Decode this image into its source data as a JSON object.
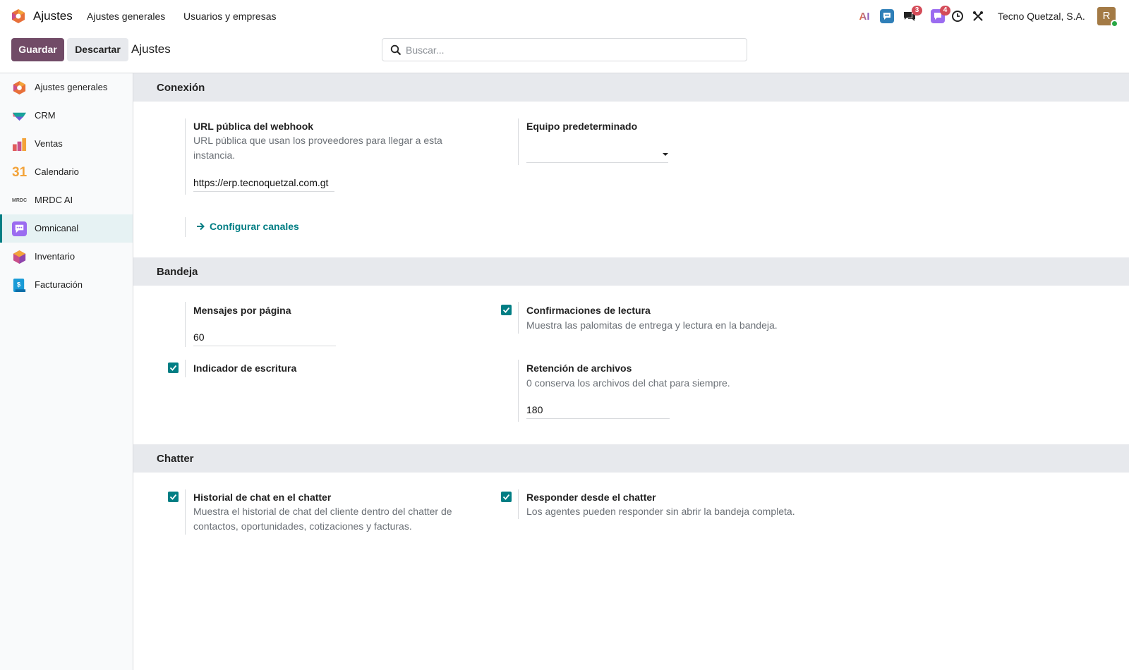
{
  "topbar": {
    "app_name": "Ajustes",
    "menus": [
      "Ajustes generales",
      "Usuarios y empresas"
    ],
    "chat_badge": "3",
    "activity_badge": "4",
    "company": "Tecno Quetzal, S.A.",
    "avatar_letter": "R",
    "ai_label": "AI"
  },
  "control": {
    "save_label": "Guardar",
    "discard_label": "Descartar",
    "breadcrumb": "Ajustes",
    "search_placeholder": "Buscar..."
  },
  "sidebar": {
    "items": [
      {
        "label": "Ajustes generales",
        "icon": "settings-hex-icon"
      },
      {
        "label": "CRM",
        "icon": "crm-icon"
      },
      {
        "label": "Ventas",
        "icon": "sales-chart-icon"
      },
      {
        "label": "Calendario",
        "icon": "calendar-icon",
        "glyph": "31"
      },
      {
        "label": "MRDC AI",
        "icon": "mrdc-ai-icon",
        "glyph": "MRDC"
      },
      {
        "label": "Omnicanal",
        "icon": "omnichannel-icon",
        "active": true
      },
      {
        "label": "Inventario",
        "icon": "inventory-cube-icon"
      },
      {
        "label": "Facturación",
        "icon": "invoice-icon"
      }
    ]
  },
  "sections": {
    "conexion": {
      "title": "Conexión",
      "webhook_title": "URL pública del webhook",
      "webhook_desc": "URL pública que usan los proveedores para llegar a esta instancia.",
      "webhook_value": "https://erp.tecnoquetzal.com.gt",
      "team_title": "Equipo predeterminado",
      "team_value": "",
      "configure_link": "Configurar canales"
    },
    "bandeja": {
      "title": "Bandeja",
      "per_page_title": "Mensajes por página",
      "per_page_value": "60",
      "read_receipts_title": "Confirmaciones de lectura",
      "read_receipts_desc": "Muestra las palomitas de entrega y lectura en la bandeja.",
      "read_receipts_checked": true,
      "typing_title": "Indicador de escritura",
      "typing_checked": true,
      "retention_title": "Retención de archivos",
      "retention_desc": "0 conserva los archivos del chat para siempre.",
      "retention_value": "180"
    },
    "chatter": {
      "title": "Chatter",
      "history_title": "Historial de chat en el chatter",
      "history_desc": "Muestra el historial de chat del cliente dentro del chatter de contactos, oportunidades, cotizaciones y facturas.",
      "history_checked": true,
      "reply_title": "Responder desde el chatter",
      "reply_desc": "Los agentes pueden responder sin abrir la bandeja completa.",
      "reply_checked": true
    }
  },
  "colors": {
    "primary": "#714b67",
    "accent": "#017e84",
    "section_bg": "#e7e9ed",
    "badge": "#d44c59"
  }
}
